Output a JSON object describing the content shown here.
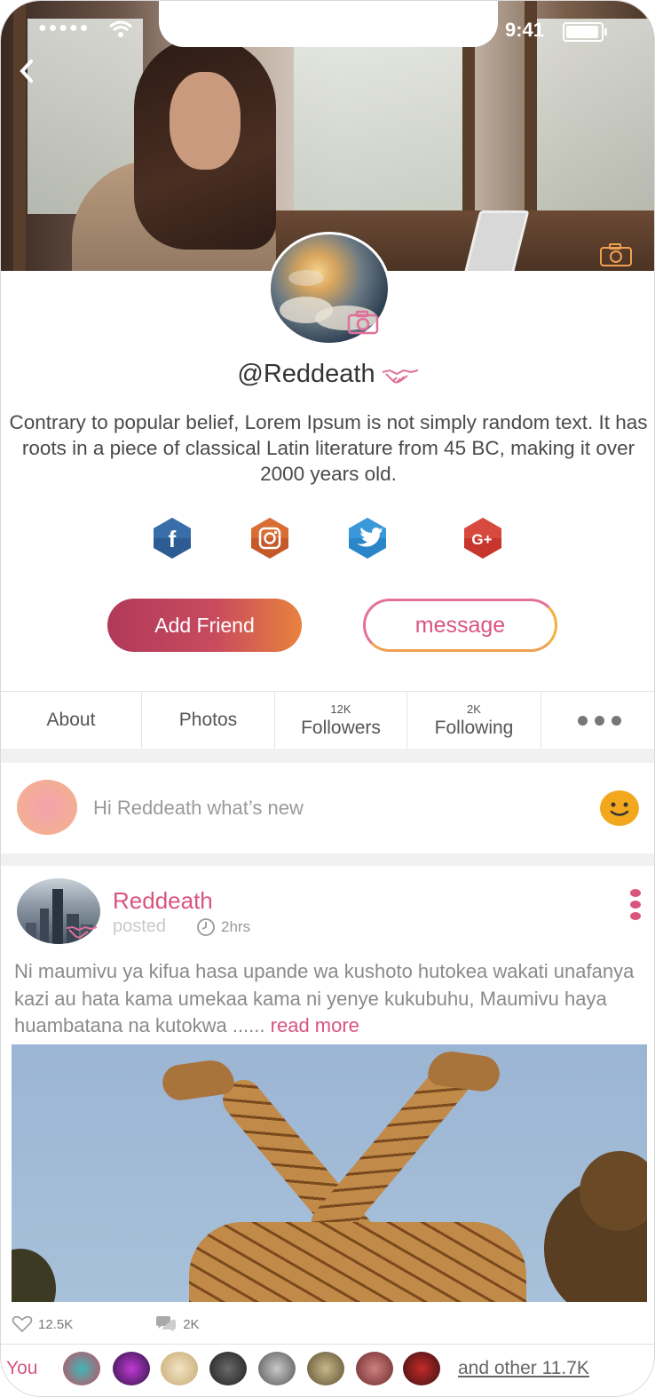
{
  "status_bar": {
    "signal": "●●●●●",
    "time": "9:41",
    "battery_level": 0.95
  },
  "profile": {
    "username": "@Reddeath",
    "bio": "Contrary to popular belief, Lorem Ipsum is not simply random text. It has roots in a piece of classical Latin literature from 45 BC, making it over 2000 years old.",
    "social": [
      "facebook-icon",
      "instagram-icon",
      "twitter-icon",
      "google-plus-icon"
    ],
    "colors": {
      "accent": "#d9557e",
      "orange": "#e8823e",
      "facebook": "#2d5c94",
      "instagram": "#c45a2a",
      "twitter": "#2a86c9",
      "google": "#c7352d"
    }
  },
  "buttons": {
    "add_friend": "Add Friend",
    "message": "message"
  },
  "tabs": {
    "about": "About",
    "photos": "Photos",
    "followers_count": "12K",
    "followers": "Followers",
    "following_count": "2K",
    "following": "Following"
  },
  "compose": {
    "placeholder": "Hi Reddeath what’s new"
  },
  "post": {
    "author": "Reddeath",
    "action": "posted",
    "time": "2hrs",
    "text": "Ni maumivu ya kifua hasa upande wa kushoto hutokea wakati unafanya kazi au hata kama umekaa kama ni yenye kukubuhu, Maumivu haya huambatana na kutokwa ......",
    "read_more": "read more",
    "likes": "12.5K",
    "comments": "2K"
  },
  "likers": {
    "you_label": "You",
    "others": "and other 11.7K"
  }
}
